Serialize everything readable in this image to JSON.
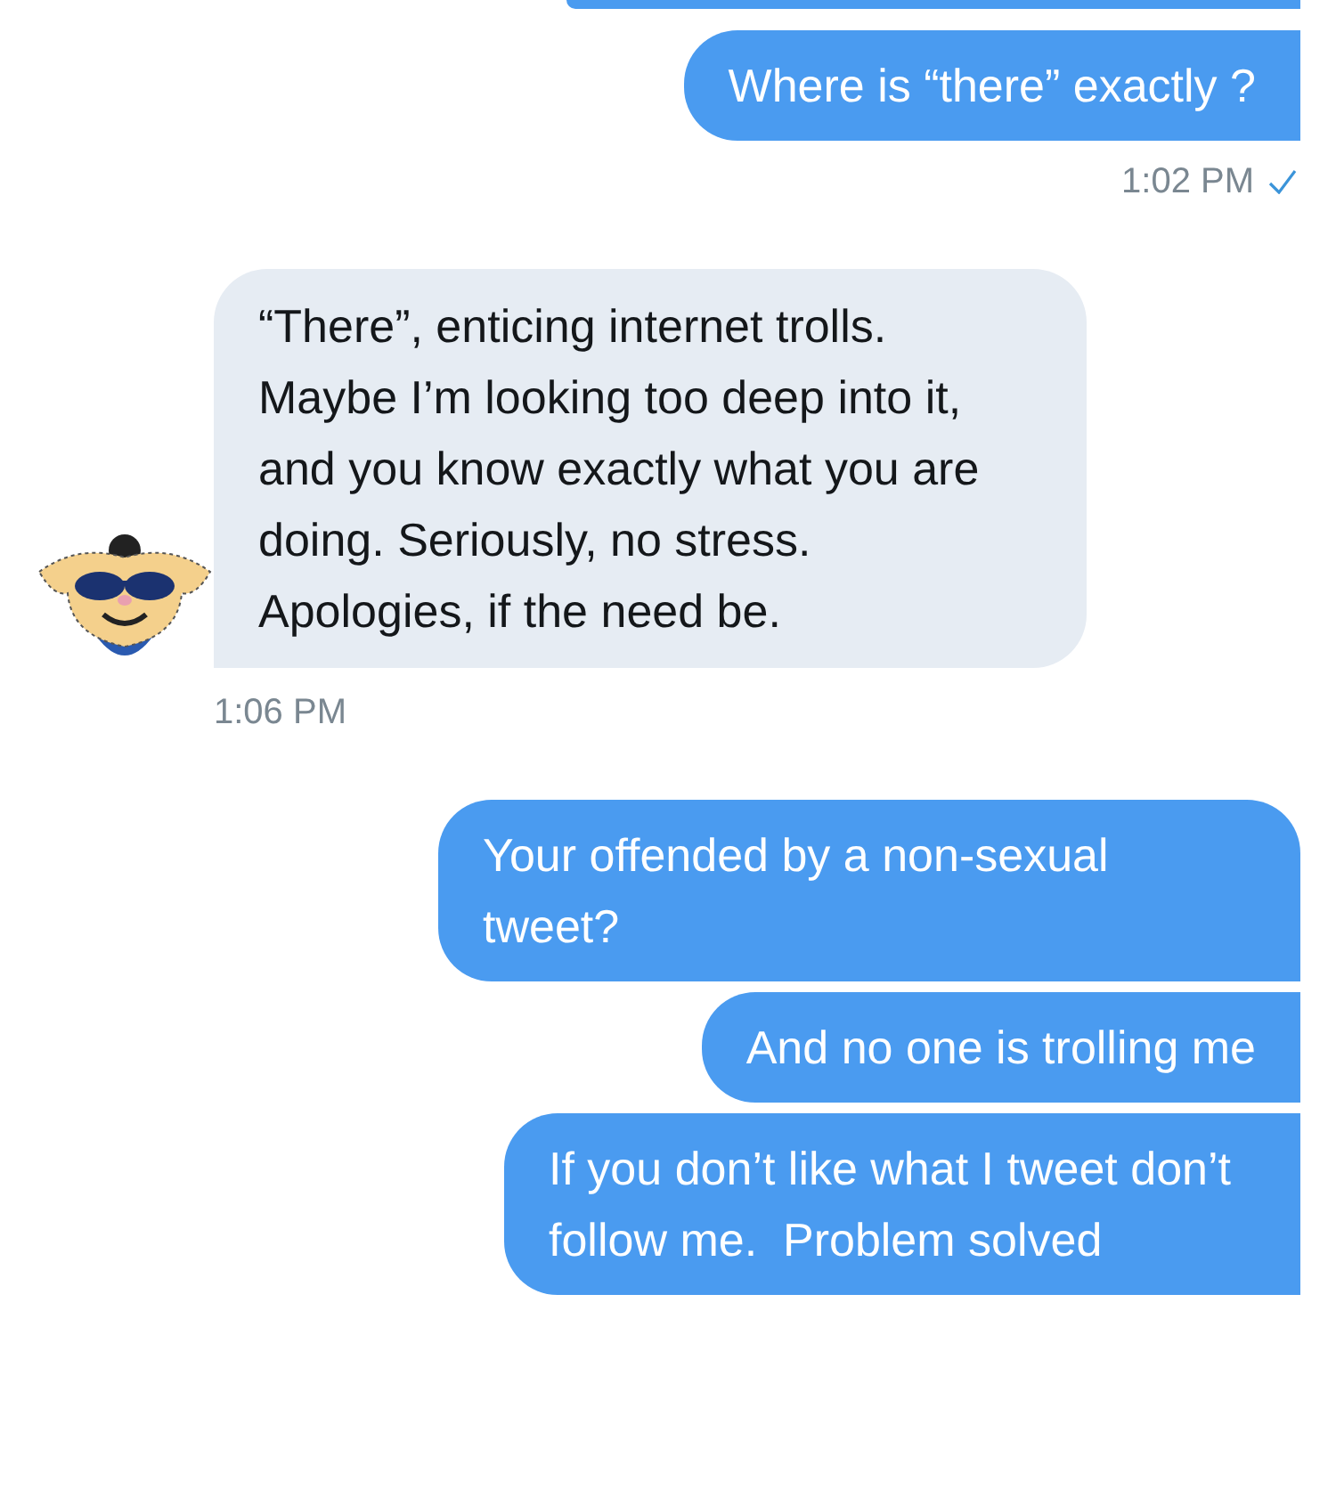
{
  "groups": [
    {
      "kind": "sent",
      "messages": [
        "Where is “there” exactly ?"
      ],
      "time": "1:02 PM",
      "read": true
    },
    {
      "kind": "received",
      "messages": [
        "“There”, enticing internet trolls. Maybe I’m looking too deep into it, and you know exactly what you are doing. Seriously, no stress. Apologies, if the need be."
      ],
      "time": "1:06 PM"
    },
    {
      "kind": "sent",
      "messages": [
        "Your offended by a non-sexual tweet?",
        "And no one is trolling me",
        "If you don’t like what I tweet don’t follow me.  Problem solved"
      ]
    }
  ]
}
